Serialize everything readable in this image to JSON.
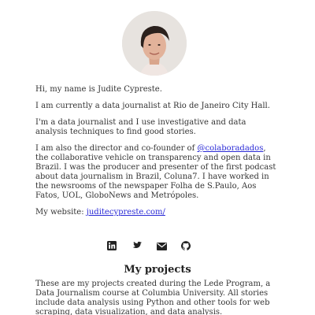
{
  "profile": {
    "avatar_alt": "avatar"
  },
  "intro": {
    "p1": "Hi, my name is Judite Cypreste.",
    "p2": "I am currently a data journalist at Rio de Janeiro City Hall.",
    "p3": "I'm a data journalist and I use investigative and data analysis techniques to find good stories.",
    "p4_prefix": "I am also the director and co-founder of ",
    "p4_link": "@colaboradados",
    "p4_suffix": ", the collaborative vehicle on transparency and open data in Brazil. I was the producer and presenter of the first podcast about data journalism in Brazil, Coluna7. I have worked in the newsrooms of the newspaper Folha de S.Paulo, Aos Fatos, UOL, GloboNews and Metrópoles.",
    "website_label": "My website: ",
    "website_link": "juditecypreste.com/"
  },
  "social": {
    "icons": [
      "linkedin-icon",
      "twitter-icon",
      "email-icon",
      "github-icon"
    ]
  },
  "projects": {
    "title": "My projects",
    "description": "These are my projects created during the Lede Program, a Data Journalism course at Columbia University. All stories include data analysis using Python and other tools for web scraping, data visualization, and data analysis."
  }
}
